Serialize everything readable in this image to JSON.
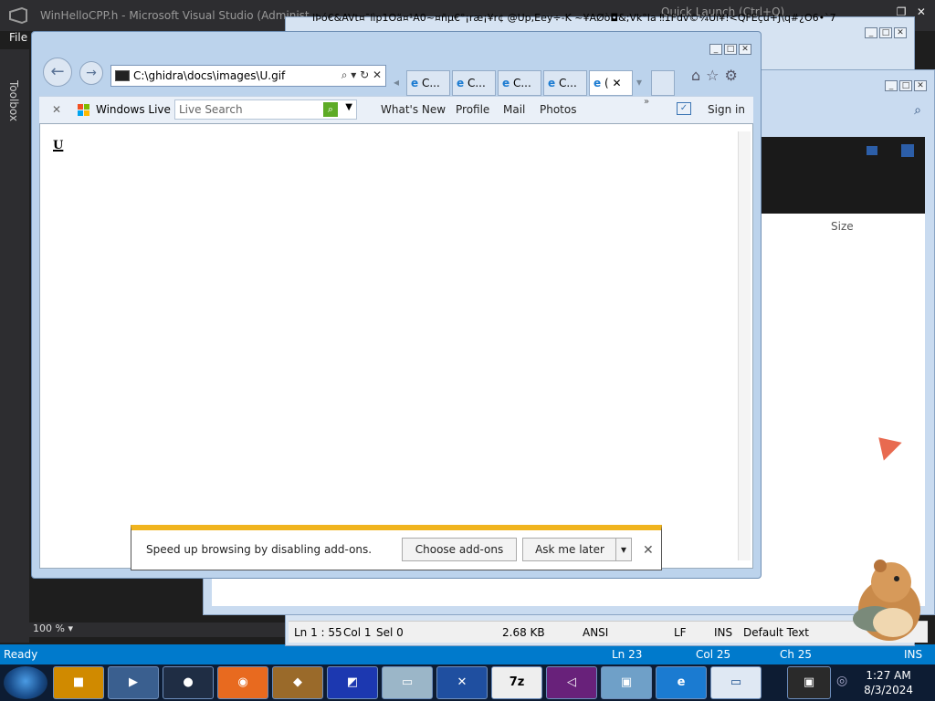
{
  "vs": {
    "title": "WinHelloCPP.h - Microsoft Visual Studio (Administ",
    "menu_file": "File",
    "quick_launch": "Quick Launch (Ctrl+Q)",
    "toolbox": "Toolbox",
    "zoom": "100 %",
    "status": {
      "ready": "Ready",
      "ln": "Ln 23",
      "col": "Col 25",
      "ch": "Ch 25",
      "ins": "INS"
    }
  },
  "garbled_title": "IÞó€&AVt¤ˉlìp1Oä¤¹A0~¤ñµ€°¡ræ¡¥r¢ @Up,Eey÷-K ~¥AØò◘&;Vk°Ia  ‼1Fdv©¼Ui¥!<QFEçu+J\\q#¿O6•`7",
  "notepad": {
    "status": {
      "pos": "Ln 1 : 55",
      "col": "Col 1",
      "sel": "Sel 0",
      "size": "2.68 KB",
      "encoding": "ANSI",
      "eol": "LF",
      "ins": "INS",
      "style": "Default Text"
    }
  },
  "explorer": {
    "size_col": "Size"
  },
  "ie": {
    "address": "C:\\ghidra\\docs\\images\\U.gif",
    "tabs": [
      {
        "label": "C..."
      },
      {
        "label": "C..."
      },
      {
        "label": "C..."
      },
      {
        "label": "C..."
      },
      {
        "label": "("
      }
    ],
    "toolbar": {
      "windows_live": "Windows Live",
      "search_placeholder": "Live Search",
      "links": [
        "What's New",
        "Profile",
        "Mail",
        "Photos"
      ],
      "sign_in": "Sign in"
    },
    "page_glyph": "U",
    "notification": {
      "message": "Speed up browsing by disabling add-ons.",
      "choose": "Choose add-ons",
      "later": "Ask me later"
    }
  },
  "taskbar": {
    "time": "1:27 AM",
    "date": "8/3/2024",
    "apps": [
      "7z"
    ]
  }
}
